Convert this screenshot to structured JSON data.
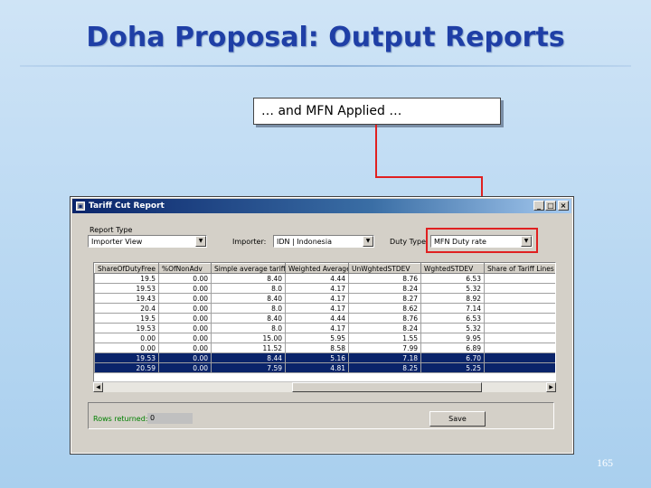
{
  "slide": {
    "title": "Doha Proposal: Output Reports",
    "callout": "… and MFN Applied …",
    "page_number": "165"
  },
  "colors": {
    "title": "#1f3fa6",
    "arrow": "#e02020",
    "selection": "#0a246a"
  },
  "window": {
    "title": "Tariff Cut Report",
    "report_type_label": "Report Type",
    "report_type_value": "Importer View",
    "importer_label": "Importer:",
    "importer_value": "IDN | Indonesia",
    "duty_type_label": "Duty Type",
    "duty_type_value": "MFN Duty rate",
    "rows_returned_label": "Rows returned:",
    "rows_returned_value": "0",
    "save_label": "Save"
  },
  "table": {
    "columns": [
      "ShareOfDutyFree",
      "%OfNonAdv",
      "Simple average tariff",
      "Weighted Average",
      "UnWghtedSTDEV",
      "WghtedSTDEV",
      "Share of Tariff Lines abo"
    ],
    "rows": [
      [
        "19.5",
        "0.00",
        "8.40",
        "4.44",
        "8.76",
        "6.53",
        ""
      ],
      [
        "19.53",
        "0.00",
        "8.0",
        "4.17",
        "8.24",
        "5.32",
        ""
      ],
      [
        "19.43",
        "0.00",
        "8.40",
        "4.17",
        "8.27",
        "8.92",
        ""
      ],
      [
        "20.4",
        "0.00",
        "8.0",
        "4.17",
        "8.62",
        "7.14",
        ""
      ],
      [
        "19.5",
        "0.00",
        "8.40",
        "4.44",
        "8.76",
        "6.53",
        ""
      ],
      [
        "19.53",
        "0.00",
        "8.0",
        "4.17",
        "8.24",
        "5.32",
        ""
      ],
      [
        "0.00",
        "0.00",
        "15.00",
        "5.95",
        "1.55",
        "9.95",
        ""
      ],
      [
        "0.00",
        "0.00",
        "11.52",
        "8.58",
        "7.99",
        "6.89",
        ""
      ],
      [
        "19.53",
        "0.00",
        "8.44",
        "5.16",
        "7.18",
        "6.70",
        ""
      ],
      [
        "20.59",
        "0.00",
        "7.59",
        "4.81",
        "8.25",
        "5.25",
        ""
      ]
    ],
    "selected_rows": [
      8,
      9
    ]
  }
}
